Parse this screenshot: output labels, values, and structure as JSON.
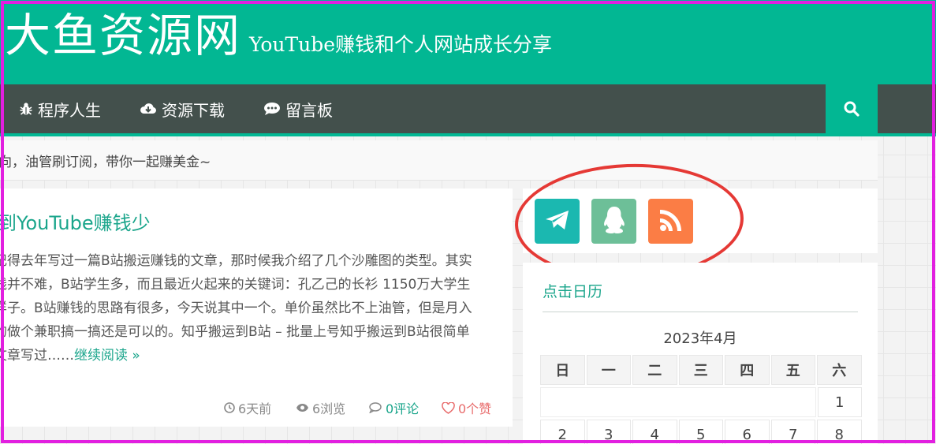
{
  "site": {
    "name": "大鱼资源网",
    "tagline": "YouTube赚钱和个人网站成长分享"
  },
  "nav": {
    "items": [
      {
        "label": "程序人生",
        "icon": "bug-icon"
      },
      {
        "label": "资源下载",
        "icon": "cloud-download-icon"
      },
      {
        "label": "留言板",
        "icon": "comment-icon"
      }
    ],
    "search_icon": "search-icon"
  },
  "notice": {
    "text": "向，油管刷订阅，带你一起赚美金~"
  },
  "post": {
    "title": "到YouTube赚钱少",
    "excerpt_lines": [
      "记得去年写过一篇B站搬运赚钱的文章，那时候我介绍了几个沙雕图的类型。其实",
      "钱并不难，B站学生多，而且最近火起来的关键词：孔乙己的长衫 1150万大学生",
      "样子。B站赚钱的思路有很多，今天说其中一个。单价虽然比不上油管，但是月入",
      "的做个兼职搞一搞还是可以的。知乎搬运到B站 – 批量上号知乎搬运到B站很简单",
      "文章写过……"
    ],
    "read_more": "继续阅读 »",
    "meta": {
      "time": "6天前",
      "views": "6浏览",
      "comments": "0评论",
      "likes": "0个赞"
    }
  },
  "social": {
    "buttons": [
      {
        "name": "telegram",
        "icon": "telegram-icon",
        "color": "#1bb8b0"
      },
      {
        "name": "qq",
        "icon": "qq-penguin-icon",
        "color": "#6dbf98"
      },
      {
        "name": "rss",
        "icon": "rss-icon",
        "color": "#fb7d45"
      }
    ]
  },
  "calendar": {
    "heading": "点击日历",
    "month": "2023年4月",
    "weekdays": [
      "日",
      "一",
      "二",
      "三",
      "四",
      "五",
      "六"
    ],
    "row1_last": "1",
    "row2": [
      "2",
      "3",
      "4",
      "5",
      "6",
      "7",
      "8"
    ]
  },
  "colors": {
    "brand": "#02b793",
    "nav_bg": "#43504c",
    "link": "#1aa58b",
    "like": "#e86b6b",
    "annotation_oval": "#e53935",
    "frame": "#e21fe0"
  }
}
